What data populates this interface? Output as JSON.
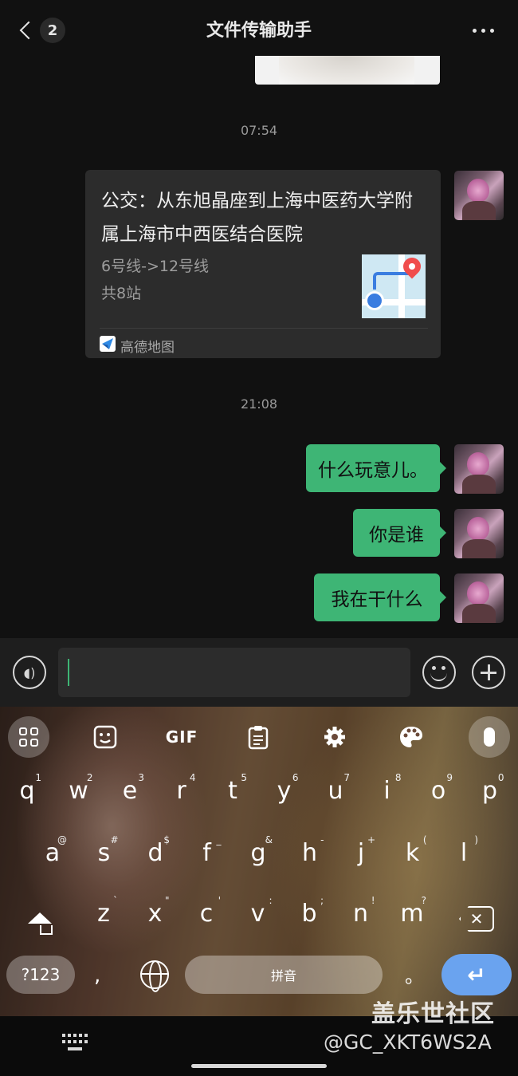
{
  "header": {
    "title": "文件传输助手",
    "unread_count": "2"
  },
  "messages": {
    "time_1": "07:54",
    "route_card": {
      "title": "公交：从东旭晶座到上海中医药大学附属上海市中西医结合医院",
      "lines": "6号线->12号线",
      "stops": "共8站",
      "source": "高德地图"
    },
    "time_2": "21:08",
    "bubbles": [
      {
        "text": "什么玩意儿。"
      },
      {
        "text": "你是谁"
      },
      {
        "text": "我在干什么"
      }
    ]
  },
  "input": {
    "value": ""
  },
  "keyboard": {
    "toolbar": {
      "gif_label": "GIF"
    },
    "row1": [
      {
        "letter": "q",
        "hint": "1"
      },
      {
        "letter": "w",
        "hint": "2"
      },
      {
        "letter": "e",
        "hint": "3"
      },
      {
        "letter": "r",
        "hint": "4"
      },
      {
        "letter": "t",
        "hint": "5"
      },
      {
        "letter": "y",
        "hint": "6"
      },
      {
        "letter": "u",
        "hint": "7"
      },
      {
        "letter": "i",
        "hint": "8"
      },
      {
        "letter": "o",
        "hint": "9"
      },
      {
        "letter": "p",
        "hint": "0"
      }
    ],
    "row2": [
      {
        "letter": "a",
        "hint": "@"
      },
      {
        "letter": "s",
        "hint": "#"
      },
      {
        "letter": "d",
        "hint": "$"
      },
      {
        "letter": "f",
        "hint": "_"
      },
      {
        "letter": "g",
        "hint": "&"
      },
      {
        "letter": "h",
        "hint": "-"
      },
      {
        "letter": "j",
        "hint": "+"
      },
      {
        "letter": "k",
        "hint": "("
      },
      {
        "letter": "l",
        "hint": ")"
      }
    ],
    "row3": [
      {
        "letter": "z",
        "hint": "`"
      },
      {
        "letter": "x",
        "hint": "\""
      },
      {
        "letter": "c",
        "hint": "'"
      },
      {
        "letter": "v",
        "hint": ":"
      },
      {
        "letter": "b",
        "hint": ";"
      },
      {
        "letter": "n",
        "hint": "!"
      },
      {
        "letter": "m",
        "hint": "?"
      }
    ],
    "symbols_label": "?123",
    "comma_label": ",",
    "space_label": "拼音",
    "period_label": "。",
    "enter_symbol": "↵"
  },
  "watermark": {
    "site": "盖乐世社区",
    "user": "@GC_XKT6WS2A"
  },
  "colors": {
    "background": "#111111",
    "bubble_green": "#3eb575",
    "card_bg": "#2c2c2c",
    "enter_blue": "#6aa3ef"
  }
}
